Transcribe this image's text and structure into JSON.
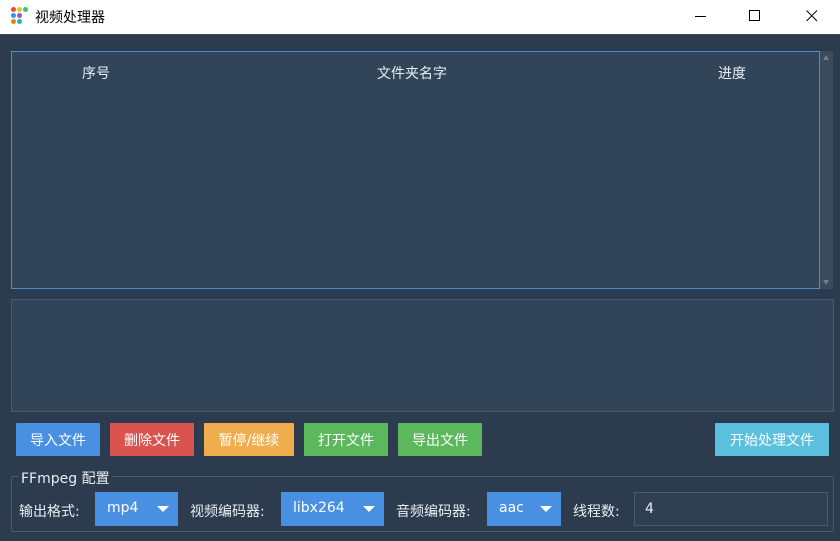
{
  "window": {
    "title": "视频处理器",
    "icon": "app-dots-icon",
    "controls": [
      "minimize-icon",
      "maximize-icon",
      "close-icon"
    ]
  },
  "table": {
    "columns": [
      "序号",
      "文件夹名字",
      "进度"
    ],
    "rows": []
  },
  "log": {
    "text": ""
  },
  "buttons": {
    "import": {
      "label": "导入文件",
      "color": "#4a90e2"
    },
    "delete": {
      "label": "删除文件",
      "color": "#d9534f"
    },
    "pause": {
      "label": "暂停/继续",
      "color": "#f0ad4e"
    },
    "open": {
      "label": "打开文件",
      "color": "#5cb85c"
    },
    "export": {
      "label": "导出文件",
      "color": "#5cb85c"
    },
    "start": {
      "label": "开始处理文件",
      "color": "#5bc0de"
    }
  },
  "ffmpeg": {
    "group_title": "FFmpeg 配置",
    "output_format_label": "输出格式:",
    "output_format_value": "mp4",
    "video_codec_label": "视频编码器:",
    "video_codec_value": "libx264",
    "audio_codec_label": "音频编码器:",
    "audio_codec_value": "aac",
    "threads_label": "线程数:",
    "threads_value": "4"
  }
}
